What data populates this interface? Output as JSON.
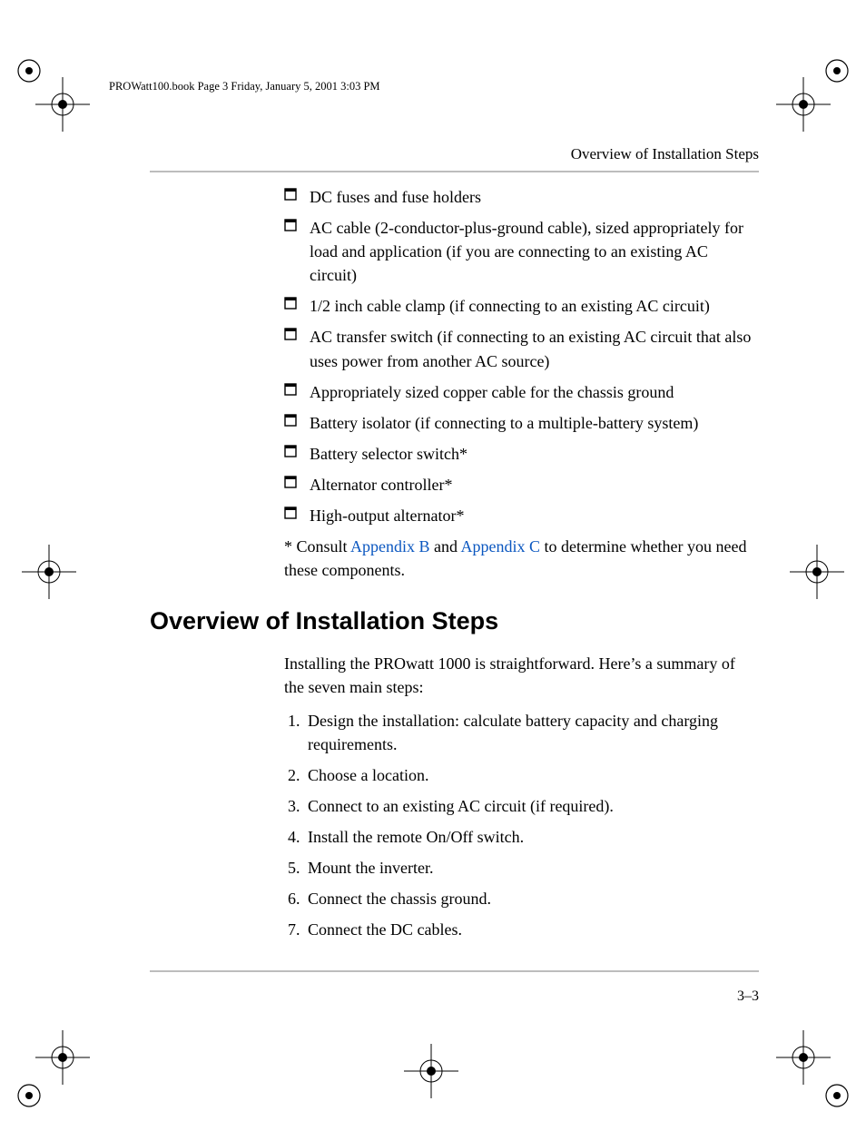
{
  "book_line": "PROWatt100.book  Page 3  Friday, January 5, 2001  3:03 PM",
  "running_head": "Overview of Installation Steps",
  "checklist": [
    "DC fuses and fuse holders",
    "AC cable (2-conductor-plus-ground cable), sized appropriately for load and application (if you are connecting to an existing AC circuit)",
    "1/2 inch cable clamp (if connecting to an existing AC circuit)",
    "AC transfer switch (if connecting to an existing AC circuit that also uses power from another AC source)",
    "Appropriately sized copper cable for the chassis ground",
    "Battery isolator (if connecting to a multiple-battery system)",
    "Battery selector switch*",
    "Alternator controller*",
    "High-output alternator*"
  ],
  "note": {
    "prefix": "* Consult ",
    "link1": "Appendix B",
    "mid": " and ",
    "link2": "Appendix C",
    "suffix": " to determine whether you need these components."
  },
  "section_heading": "Overview of Installation Steps",
  "intro": "Installing the PROwatt 1000 is straightforward. Here’s a summary of the seven main steps:",
  "steps": [
    "Design the installation: calculate battery capacity and charging requirements.",
    "Choose a location.",
    "Connect to an existing AC circuit (if required).",
    "Install the remote On/Off switch.",
    "Mount the inverter.",
    "Connect the chassis ground.",
    "Connect the DC cables."
  ],
  "page_number": "3–3"
}
